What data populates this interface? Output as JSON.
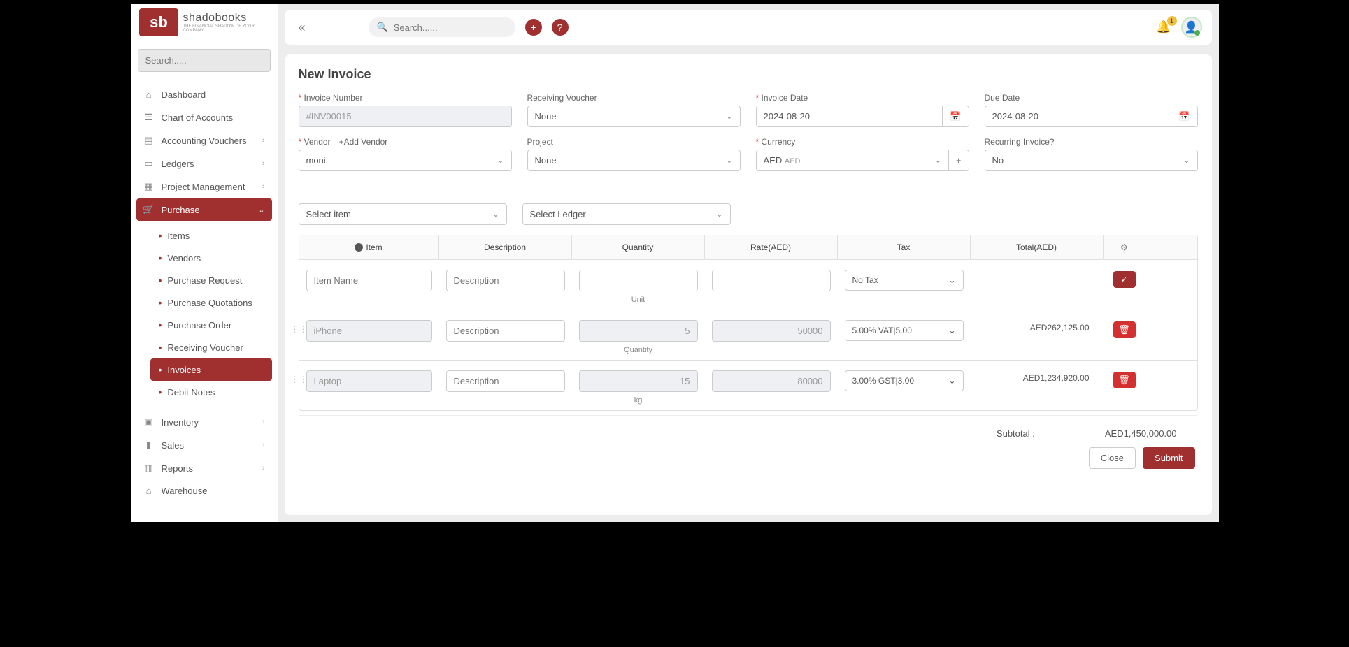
{
  "logo": {
    "brand": "shadobooks",
    "tagline": "THE FINANCIAL SHADOW OF YOUR COMPANY",
    "mark": "sb"
  },
  "sidebar": {
    "search_placeholder": "Search.....",
    "items": {
      "dashboard": "Dashboard",
      "chart_accounts": "Chart of Accounts",
      "acc_vouchers": "Accounting Vouchers",
      "ledgers": "Ledgers",
      "project_mgmt": "Project Management",
      "purchase": "Purchase",
      "inventory": "Inventory",
      "sales": "Sales",
      "reports": "Reports",
      "warehouse": "Warehouse"
    },
    "purchase_sub": {
      "items": "Items",
      "vendors": "Vendors",
      "pr": "Purchase Request",
      "pq": "Purchase Quotations",
      "po": "Purchase Order",
      "rv": "Receiving Voucher",
      "inv": "Invoices",
      "dn": "Debit Notes"
    }
  },
  "topbar": {
    "search_placeholder": "Search......",
    "notif_count": "1"
  },
  "page": {
    "title": "New Invoice"
  },
  "form": {
    "invoice_number": {
      "label": "Invoice Number",
      "value": "#INV00015"
    },
    "receiving_voucher": {
      "label": "Receiving Voucher",
      "value": "None"
    },
    "invoice_date": {
      "label": "Invoice Date",
      "value": "2024-08-20"
    },
    "due_date": {
      "label": "Due Date",
      "value": "2024-08-20"
    },
    "vendor": {
      "label": "Vendor",
      "add": "+Add Vendor",
      "value": "moni"
    },
    "project": {
      "label": "Project",
      "value": "None"
    },
    "currency": {
      "label": "Currency",
      "value": "AED",
      "sub": "AED"
    },
    "recurring": {
      "label": "Recurring Invoice?",
      "value": "No"
    }
  },
  "items": {
    "select_item": "Select item",
    "select_ledger": "Select Ledger",
    "headers": {
      "item": "Item",
      "desc": "Description",
      "qty": "Quantity",
      "rate": "Rate(AED)",
      "tax": "Tax",
      "total": "Total(AED)"
    },
    "new_row": {
      "item_ph": "Item Name",
      "desc_ph": "Description",
      "unit": "Unit",
      "tax": "No Tax"
    },
    "rows": [
      {
        "item": "iPhone",
        "desc_ph": "Description",
        "qty": "5",
        "rate": "50000",
        "tax": "5.00% VAT|5.00",
        "total": "AED262,125.00",
        "unit": "Quantity"
      },
      {
        "item": "Laptop",
        "desc_ph": "Description",
        "qty": "15",
        "rate": "80000",
        "tax": "3.00% GST|3.00",
        "total": "AED1,234,920.00",
        "unit": "kg"
      }
    ]
  },
  "summary": {
    "subtotal_label": "Subtotal :",
    "subtotal_value": "AED1,450,000.00"
  },
  "buttons": {
    "close": "Close",
    "submit": "Submit"
  }
}
